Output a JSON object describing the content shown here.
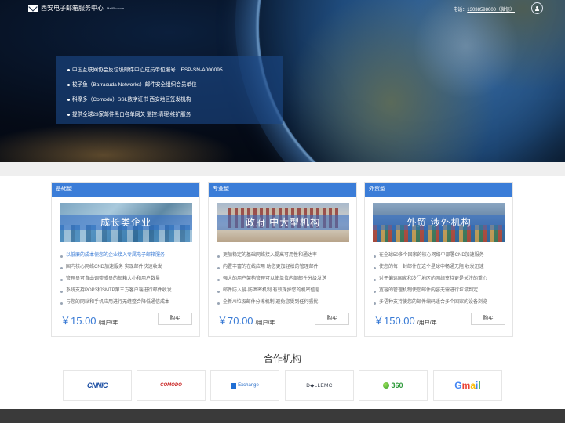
{
  "header": {
    "brand_title": "西安电子邮箱服务中心",
    "brand_sub": "MailPro.com",
    "contact_label": "电话：",
    "contact_phone": "13038598000（微信）"
  },
  "hero": {
    "items": [
      "中国互联网协会反垃圾邮件中心成员单位编号：ESP-SN-A000095",
      "梭子鱼（Barracuda Networks）邮件安全组织会员单位",
      "科摩多（Comodo）SSL数字证书 西安地区签发机构",
      "提供全球23家邮件黑白名单网关 监控:清理:维护服务"
    ]
  },
  "products": [
    {
      "type": "基础型",
      "banner": "成长类企业",
      "features": [
        "以低廉的成本使您的企业接入专属电子邮箱服务",
        "国内核心网络CND加速服务 实现邮件快速收发",
        "管理员可自由调整成员的邮箱大小和用户数量",
        "系统支持POP3和SMTP第三方客户端进行邮件收发",
        "与您的网站和手机应用进行无缝整合降低通信成本"
      ],
      "price": "￥15.00",
      "unit": "/用户/年",
      "buy": "购买"
    },
    {
      "type": "专业型",
      "banner": "政府 中大型机构",
      "features": [
        "更加稳定的基础网络接入提高可用性和通达率",
        "内置丰富的在线应用 助您更加轻松的管理邮件",
        "强大的用户架构管理可以使单位内部邮件分级发送",
        "邮件防入侵·防泄密机制 有效保护您的机密信息",
        "全新AI垃圾邮件分拣机制 避免您受到任何骚扰"
      ],
      "price": "￥70.00",
      "unit": "/用户/年",
      "buy": "购买"
    },
    {
      "type": "外贸型",
      "banner": "外贸 涉外机构",
      "features": [
        "在全球50多个国家的核心网络中部署CND加速服务",
        "使您的每一封邮件在这个星球中畅通无阻 收发迅速",
        "对于偏远国家和冷门地区的网络支持更是关注的重心",
        "宽容的管理机制使您邮件内容无需进行垃圾判定",
        "多语种支持使您的邮件编码适合多个国家的设备浏览"
      ],
      "price": "￥150.00",
      "unit": "/用户/年",
      "buy": "购买"
    }
  ],
  "partners": {
    "title": "合作机构",
    "logos": {
      "cnnic": "CNNIC",
      "comodo": "COMODO",
      "exchange": "Exchange",
      "dellemc": "D◆LLEMC",
      "s360": "360",
      "gmail": [
        "G",
        "m",
        "a",
        "i",
        "l"
      ]
    }
  }
}
